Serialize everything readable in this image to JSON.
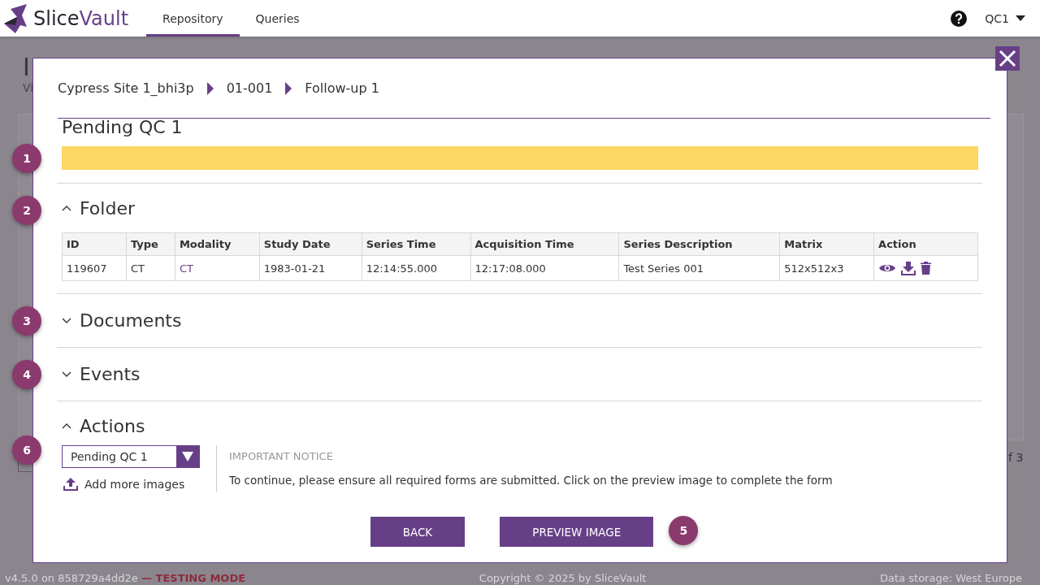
{
  "header": {
    "brand": {
      "first": "Slice",
      "second": "Vault"
    },
    "nav": [
      {
        "label": "Repository",
        "selected": true
      },
      {
        "label": "Queries",
        "selected": false
      }
    ],
    "user": "QC1"
  },
  "background": {
    "title": "I",
    "subtitle": "Vi",
    "pager": "f 3"
  },
  "footer": {
    "version": "v4.5.0 on 858729a4dd2e",
    "mode": "— TESTING MODE",
    "copyright": "Copyright © 2025 by SliceVault",
    "storage": "Data storage: West Europe"
  },
  "dialog": {
    "breadcrumb": [
      "Cypress Site 1_bhi3p",
      "01-001",
      "Follow-up 1"
    ],
    "status": {
      "title": "Pending QC 1",
      "color": "#fdd663",
      "badge": "1"
    },
    "sections": [
      {
        "kind": "table",
        "title": "Folder",
        "expanded": true,
        "badge": "2",
        "columns": [
          "ID",
          "Type",
          "Modality",
          "Study Date",
          "Series Time",
          "Acquisition Time",
          "Series Description",
          "Matrix",
          "Action"
        ],
        "rows": [
          [
            "119607",
            "CT",
            "CT",
            "1983-01-21",
            "12:14:55.000",
            "12:17:08.000",
            "Test Series 001",
            "512x512x3"
          ]
        ]
      },
      {
        "kind": "empty",
        "title": "Documents",
        "expanded": false,
        "badge": "3"
      },
      {
        "kind": "empty",
        "title": "Events",
        "expanded": false,
        "badge": "4"
      },
      {
        "kind": "actions",
        "title": "Actions",
        "expanded": true,
        "badge": "6",
        "select": "Pending QC 1",
        "add_link": "Add more images",
        "notice_title": "IMPORTANT NOTICE",
        "notice_text": "To continue, please ensure all required forms are submitted. Click on the preview image to complete the form"
      }
    ],
    "buttons": [
      {
        "label": "BACK"
      },
      {
        "label": "PREVIEW IMAGE",
        "badge": "5"
      }
    ]
  }
}
